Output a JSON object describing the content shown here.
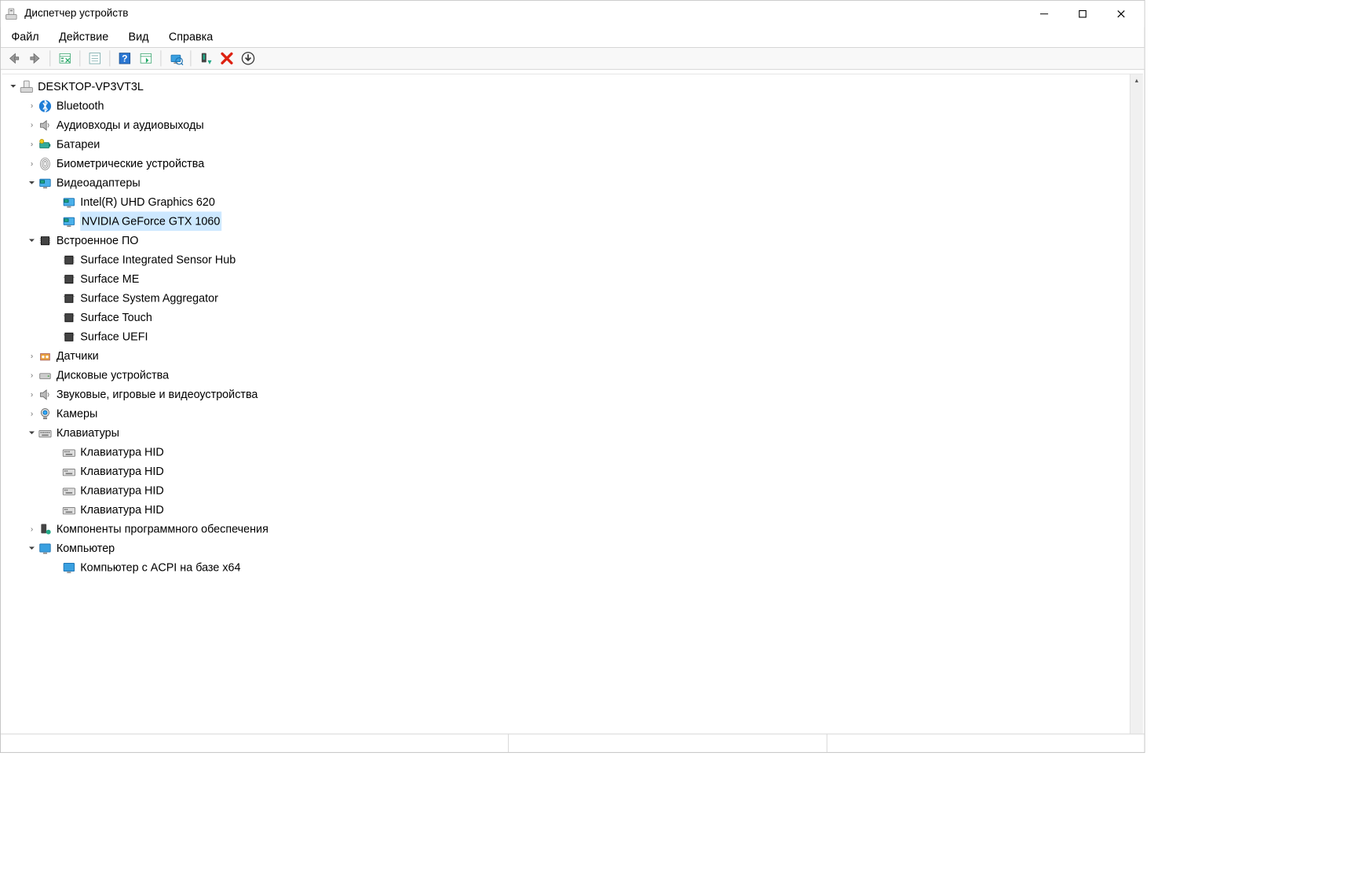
{
  "window": {
    "title": "Диспетчер устройств"
  },
  "menu": {
    "file": "Файл",
    "action": "Действие",
    "view": "Вид",
    "help": "Справка"
  },
  "tree": {
    "root": "DESKTOP-VP3VT3L",
    "bluetooth": "Bluetooth",
    "audio_io": "Аудиовходы и аудиовыходы",
    "batteries": "Батареи",
    "biometric": "Биометрические устройства",
    "video_adapters": "Видеоадаптеры",
    "video_adapters_children": {
      "intel": "Intel(R) UHD Graphics 620",
      "nvidia": "NVIDIA GeForce GTX 1060"
    },
    "firmware": "Встроенное ПО",
    "firmware_children": {
      "sensor_hub": "Surface Integrated Sensor Hub",
      "me": "Surface ME",
      "sys_agg": "Surface System Aggregator",
      "touch": "Surface Touch",
      "uefi": "Surface UEFI"
    },
    "sensors": "Датчики",
    "disks": "Дисковые устройства",
    "sound_game_video": "Звуковые, игровые и видеоустройства",
    "cameras": "Камеры",
    "keyboards": "Клавиатуры",
    "keyboards_children": {
      "k1": "Клавиатура HID",
      "k2": "Клавиатура HID",
      "k3": "Клавиатура HID",
      "k4": "Клавиатура HID"
    },
    "software_components": "Компоненты программного обеспечения",
    "computer": "Компьютер",
    "computer_children": {
      "acpi": "Компьютер с ACPI на базе x64"
    }
  }
}
